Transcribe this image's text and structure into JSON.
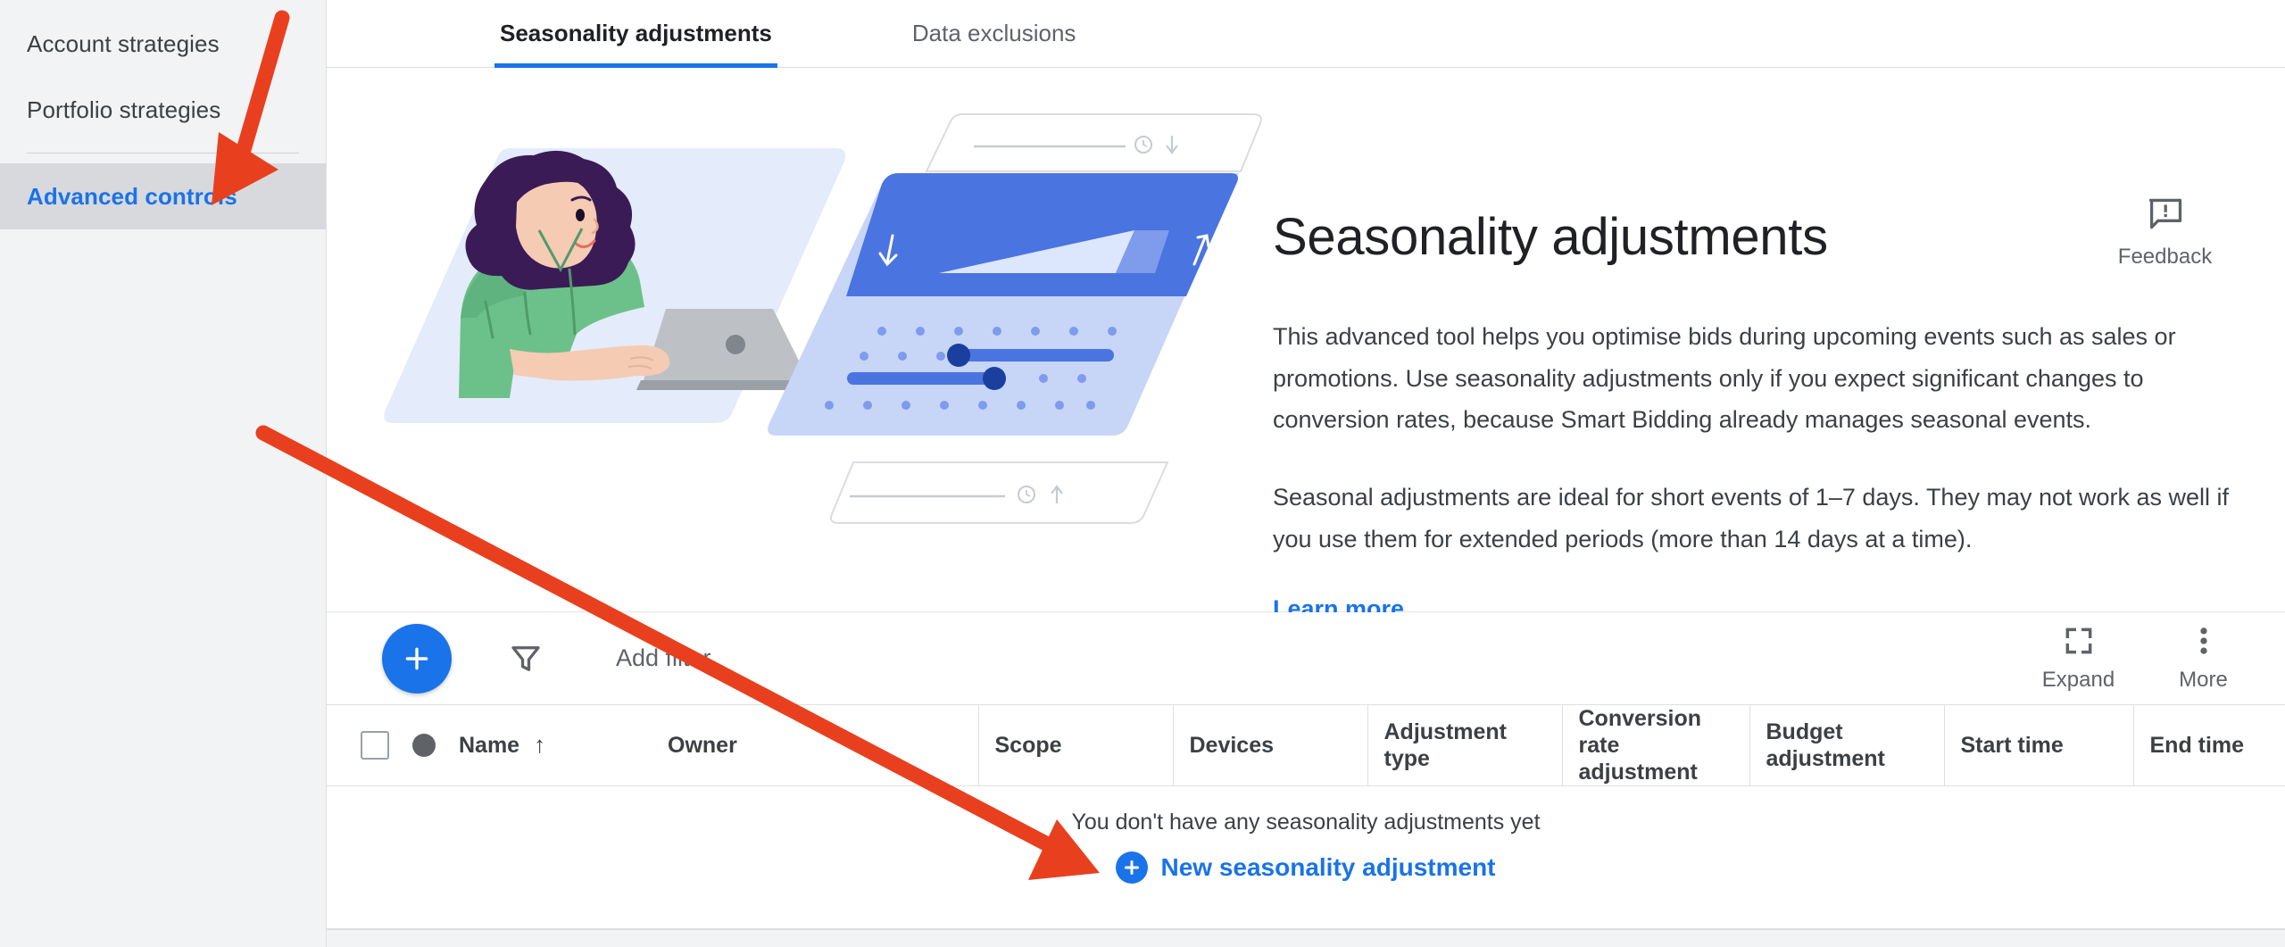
{
  "sidebar": {
    "items": [
      {
        "label": "Account strategies",
        "active": false
      },
      {
        "label": "Portfolio strategies",
        "active": false
      },
      {
        "label": "Advanced controls",
        "active": true
      }
    ]
  },
  "tabs": [
    {
      "label": "Seasonality adjustments",
      "active": true
    },
    {
      "label": "Data exclusions",
      "active": false
    }
  ],
  "hero": {
    "title": "Seasonality adjustments",
    "paragraph1": "This advanced tool helps you optimise bids during upcoming events such as sales or promotions. Use seasonality adjustments only if you expect significant changes to conversion rates, because Smart Bidding already manages seasonal events.",
    "paragraph2": "Seasonal adjustments are ideal for short events of 1–7 days. They may not work as well if you use them for extended periods (more than 14 days at a time).",
    "learn_more": "Learn more",
    "feedback_label": "Feedback",
    "feedback_icon": "feedback-speech-bubble-icon"
  },
  "toolbar": {
    "add_button_icon": "plus-icon",
    "filter_icon": "funnel-icon",
    "add_filter_label": "Add filter",
    "expand_label": "Expand",
    "expand_icon": "expand-icon",
    "more_label": "More",
    "more_icon": "more-vertical-icon"
  },
  "table": {
    "columns": [
      {
        "label": "Name",
        "sort": "↑"
      },
      {
        "label": "Owner"
      },
      {
        "label": "Scope"
      },
      {
        "label": "Devices"
      },
      {
        "label": "Adjustment type"
      },
      {
        "label": "Conversion rate adjustment"
      },
      {
        "label": "Budget adjustment"
      },
      {
        "label": "Start time"
      },
      {
        "label": "End time"
      }
    ],
    "empty_message": "You don't have any seasonality adjustments yet",
    "empty_cta": "New seasonality adjustment",
    "rows": []
  },
  "colors": {
    "accent_blue": "#1a73e8",
    "sidebar_bg": "#f1f3f4",
    "sidebar_active_bg": "#d7d9dd",
    "text_primary": "#202124",
    "text_secondary": "#5f6368",
    "annotation_red": "#ea4335"
  },
  "annotations": [
    {
      "name": "arrow-to-advanced-controls",
      "color": "#e8401f"
    },
    {
      "name": "arrow-to-new-seasonality-adjustment",
      "color": "#e8401f"
    }
  ]
}
